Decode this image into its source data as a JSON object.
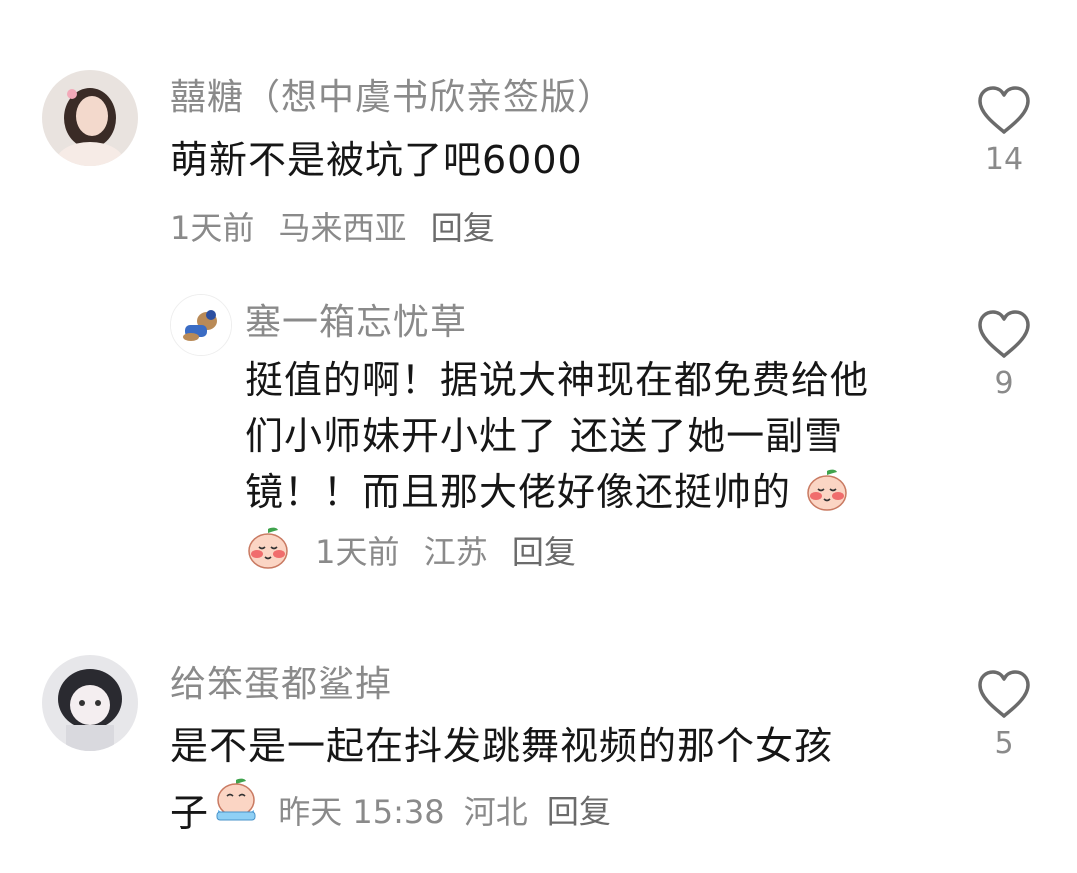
{
  "comments": [
    {
      "username": "囍糖（想中虞书欣亲签版）",
      "text": "萌新不是被坑了吧6000",
      "time": "1天前",
      "location": "马来西亚",
      "reply_label": "回复",
      "likes": "14",
      "reply": {
        "username": "塞一箱忘忧草",
        "text_line1": "挺值的啊！据说大神现在都免费给他",
        "text_line2": "们小师妹开小灶了 还送了她一副雪",
        "text_line3": "镜！！而且那大佬好像还挺帅的",
        "time": "1天前",
        "location": "江苏",
        "reply_label": "回复",
        "likes": "9"
      }
    },
    {
      "username": "给笨蛋都鲨掉",
      "text_line1": "是不是一起在抖发跳舞视频的那个女孩",
      "text_line2": "子",
      "time": "昨天 15:38",
      "location": "河北",
      "reply_label": "回复",
      "likes": "5"
    }
  ],
  "icons": {
    "like": "heart-outline-icon",
    "emoji_blush": "blushing-peach-emoji",
    "emoji_cry": "crying-peach-emoji"
  },
  "colors": {
    "text_primary": "#161616",
    "text_secondary": "#8a8a8a"
  }
}
